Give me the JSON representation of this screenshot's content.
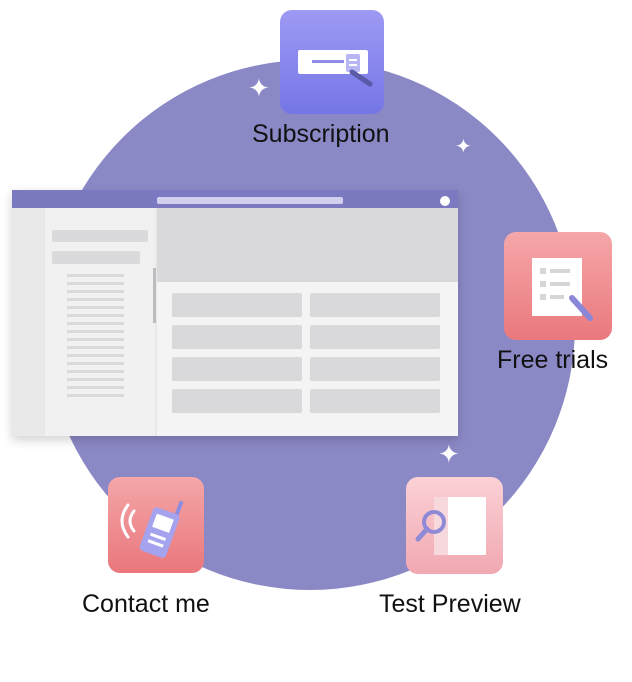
{
  "features": {
    "subscription": {
      "label": "Subscription",
      "icon": "card-with-pen-icon",
      "color": "#8584ee"
    },
    "free_trials": {
      "label": "Free trials",
      "icon": "checklist-with-pen-icon",
      "color": "#ef8c90"
    },
    "contact_me": {
      "label": "Contact me",
      "icon": "walkie-talkie-icon",
      "color": "#ee8a8e"
    },
    "test_preview": {
      "label": "Test Preview",
      "icon": "magnifier-document-icon",
      "color": "#f6bcc3"
    }
  },
  "colors": {
    "hub_circle": "#8b88c6",
    "window_accent": "#7b79bf"
  }
}
